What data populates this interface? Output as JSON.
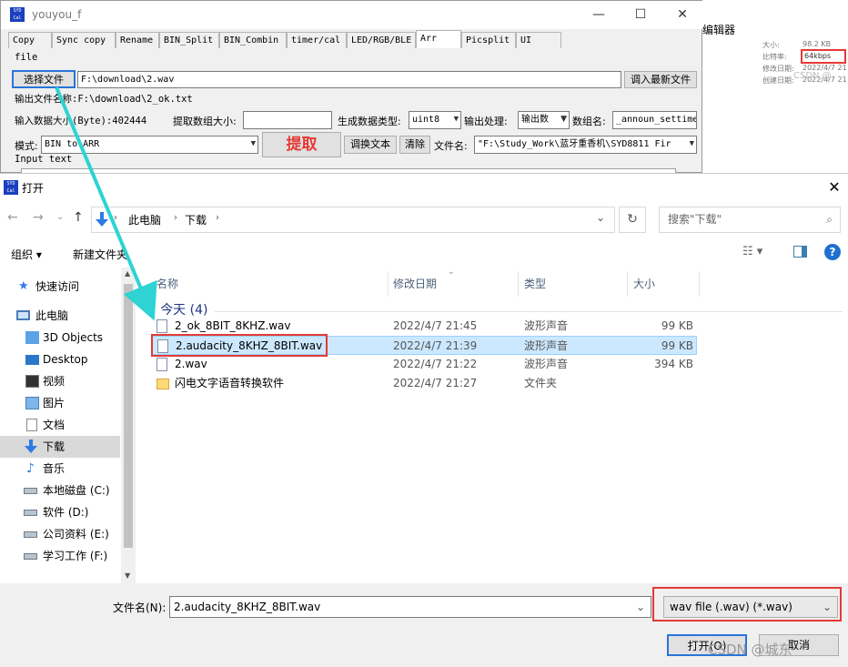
{
  "bgwin": {
    "title": "youyou_f",
    "icon_text": "SYD Cal",
    "tabs": [
      "Copy",
      "Sync copy",
      "Rename",
      "BIN_Split",
      "BIN_Combin",
      "timer/cal",
      "LED/RGB/BLE",
      "Arr",
      "Picsplit",
      "UI"
    ],
    "file_label": "file",
    "select_file_btn": "选择文件",
    "file_path": "F:\\download\\2.wav",
    "load_latest_btn": "调入最新文件",
    "output_name": "输出文件名称:F:\\download\\2_ok.txt",
    "input_size": "输入数据大小(Byte):402444",
    "extract_size_label": "提取数组大小:",
    "gen_type_label": "生成数据类型:",
    "gen_type_value": "uint8",
    "out_proc_label": "输出处理:",
    "out_proc_value": "输出数",
    "array_name_label": "数组名:",
    "array_name_value": "_announ_settime",
    "mode_label": "模式:",
    "mode_value": "BIN to ARR",
    "extract_btn": "提取",
    "swap_btn": "调换文本",
    "clear_btn": "清除",
    "filename_label": "文件名:",
    "filename_value": "\"F:\\Study_Work\\蓝牙重香机\\SYD8811 Fir",
    "input_text_label": "Input text"
  },
  "right_panel": {
    "editor": "编辑器",
    "size_label": "大小:",
    "size_value": "98.2 KB",
    "bitrate_label": "比特率:",
    "bitrate_value": "64kbps",
    "modified_label": "修改日期:",
    "modified_value": "2022/4/7 21",
    "created_label": "创建日期:",
    "created_value": "2022/4/7 21"
  },
  "dialog": {
    "title": "打开",
    "breadcrumb": [
      "此电脑",
      "下载"
    ],
    "search_placeholder": "搜索\"下载\"",
    "toolbar": {
      "organize": "组织 ▾",
      "new_folder": "新建文件夹"
    },
    "nav": [
      {
        "label": "快速访问",
        "icon": "star-icon"
      },
      {
        "label": "此电脑",
        "icon": "computer-icon"
      },
      {
        "label": "3D Objects",
        "icon": "3d-objects-icon"
      },
      {
        "label": "Desktop",
        "icon": "desktop-icon"
      },
      {
        "label": "视频",
        "icon": "video-icon"
      },
      {
        "label": "图片",
        "icon": "pictures-icon"
      },
      {
        "label": "文档",
        "icon": "documents-icon"
      },
      {
        "label": "下载",
        "icon": "download-icon"
      },
      {
        "label": "音乐",
        "icon": "music-icon"
      },
      {
        "label": "本地磁盘 (C:)",
        "icon": "drive-c-icon"
      },
      {
        "label": "软件 (D:)",
        "icon": "drive-d-icon"
      },
      {
        "label": "公司资料 (E:)",
        "icon": "drive-e-icon"
      },
      {
        "label": "学习工作 (F:)",
        "icon": "drive-f-icon"
      }
    ],
    "columns": [
      "名称",
      "修改日期",
      "类型",
      "大小"
    ],
    "group": "今天 (4)",
    "files": [
      {
        "name": "2_ok_8BIT_8KHZ.wav",
        "date": "2022/4/7 21:45",
        "type": "波形声音",
        "size": "99 KB"
      },
      {
        "name": "2.audacity_8KHZ_8BIT.wav",
        "date": "2022/4/7 21:39",
        "type": "波形声音",
        "size": "99 KB"
      },
      {
        "name": "2.wav",
        "date": "2022/4/7 21:22",
        "type": "波形声音",
        "size": "394 KB"
      },
      {
        "name": "闪电文字语音转换软件",
        "date": "2022/4/7 21:27",
        "type": "文件夹",
        "size": ""
      }
    ],
    "filename_label": "文件名(N):",
    "filename_value": "2.audacity_8KHZ_8BIT.wav",
    "filter_value": "wav file (.wav) (*.wav)",
    "open_btn": "打开(O)",
    "cancel_btn": "取消"
  },
  "watermark": "CSDN @城东",
  "watermark_small": "CSDN @"
}
